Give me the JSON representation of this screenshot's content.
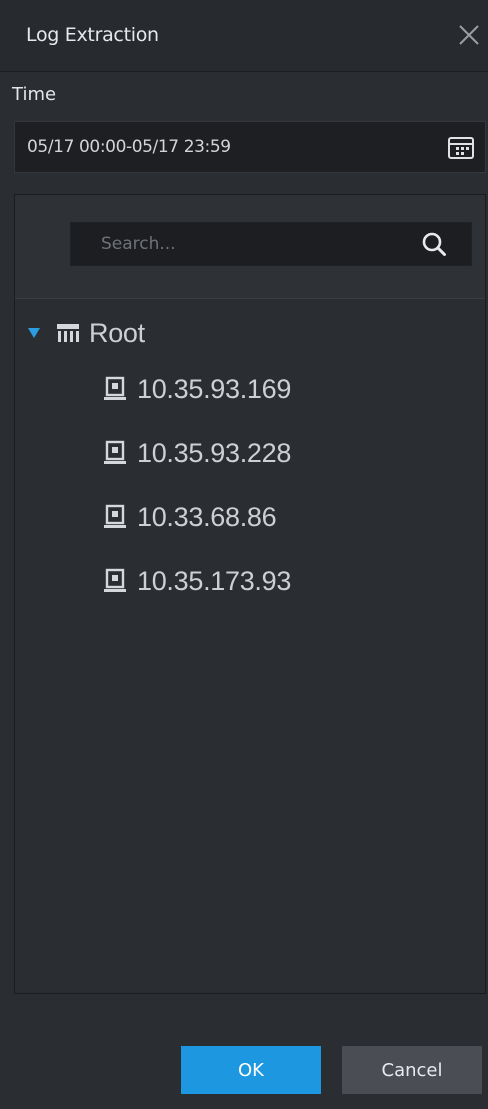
{
  "dialog": {
    "title": "Log Extraction",
    "close_icon": "close-icon"
  },
  "time": {
    "label": "Time",
    "value": "05/17 00:00-05/17 23:59",
    "calendar_icon": "calendar-icon"
  },
  "search": {
    "placeholder": "Search...",
    "value": "",
    "icon": "search-icon"
  },
  "tree": {
    "root": {
      "label": "Root",
      "expanded": true,
      "icon": "organization-icon"
    },
    "devices": [
      {
        "label": "10.35.93.169",
        "icon": "device-icon"
      },
      {
        "label": "10.35.93.228",
        "icon": "device-icon"
      },
      {
        "label": "10.33.68.86",
        "icon": "device-icon"
      },
      {
        "label": "10.35.173.93",
        "icon": "device-icon"
      }
    ]
  },
  "buttons": {
    "ok": "OK",
    "cancel": "Cancel"
  },
  "colors": {
    "background": "#2a2d31",
    "input_background": "#1d1f22",
    "accent": "#1d98e0",
    "secondary_button": "#4a4e54",
    "expand_arrow": "#2b9de0"
  }
}
